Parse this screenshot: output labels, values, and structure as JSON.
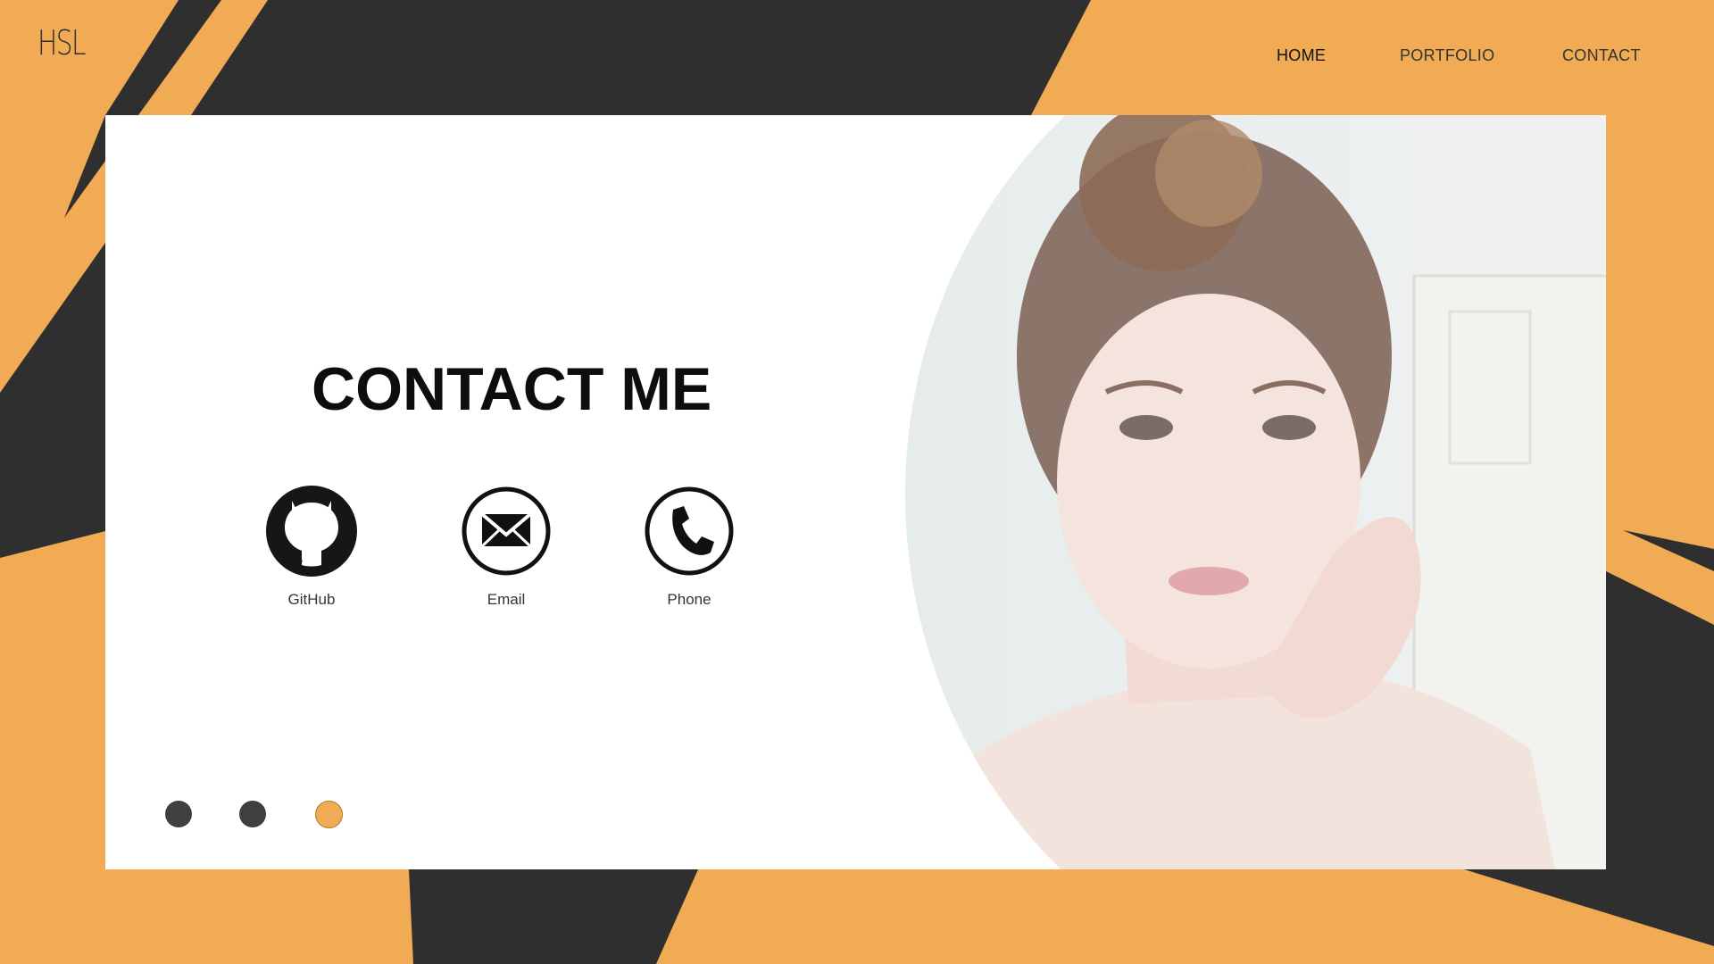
{
  "brand": {
    "logo_text": "HSL"
  },
  "nav": {
    "items": [
      {
        "label": "HOME",
        "active": true
      },
      {
        "label": "PORTFOLIO",
        "active": false
      },
      {
        "label": "CONTACT",
        "active": false
      }
    ]
  },
  "main": {
    "title": "CONTACT ME",
    "contacts": [
      {
        "label": "GitHub",
        "icon": "github-icon"
      },
      {
        "label": "Email",
        "icon": "envelope-icon"
      },
      {
        "label": "Phone",
        "icon": "phone-icon"
      }
    ],
    "pager": {
      "total": 3,
      "active_index": 3
    }
  },
  "colors": {
    "accent": "#f0ab54",
    "dark": "#2f2f2f",
    "card": "#ffffff"
  }
}
